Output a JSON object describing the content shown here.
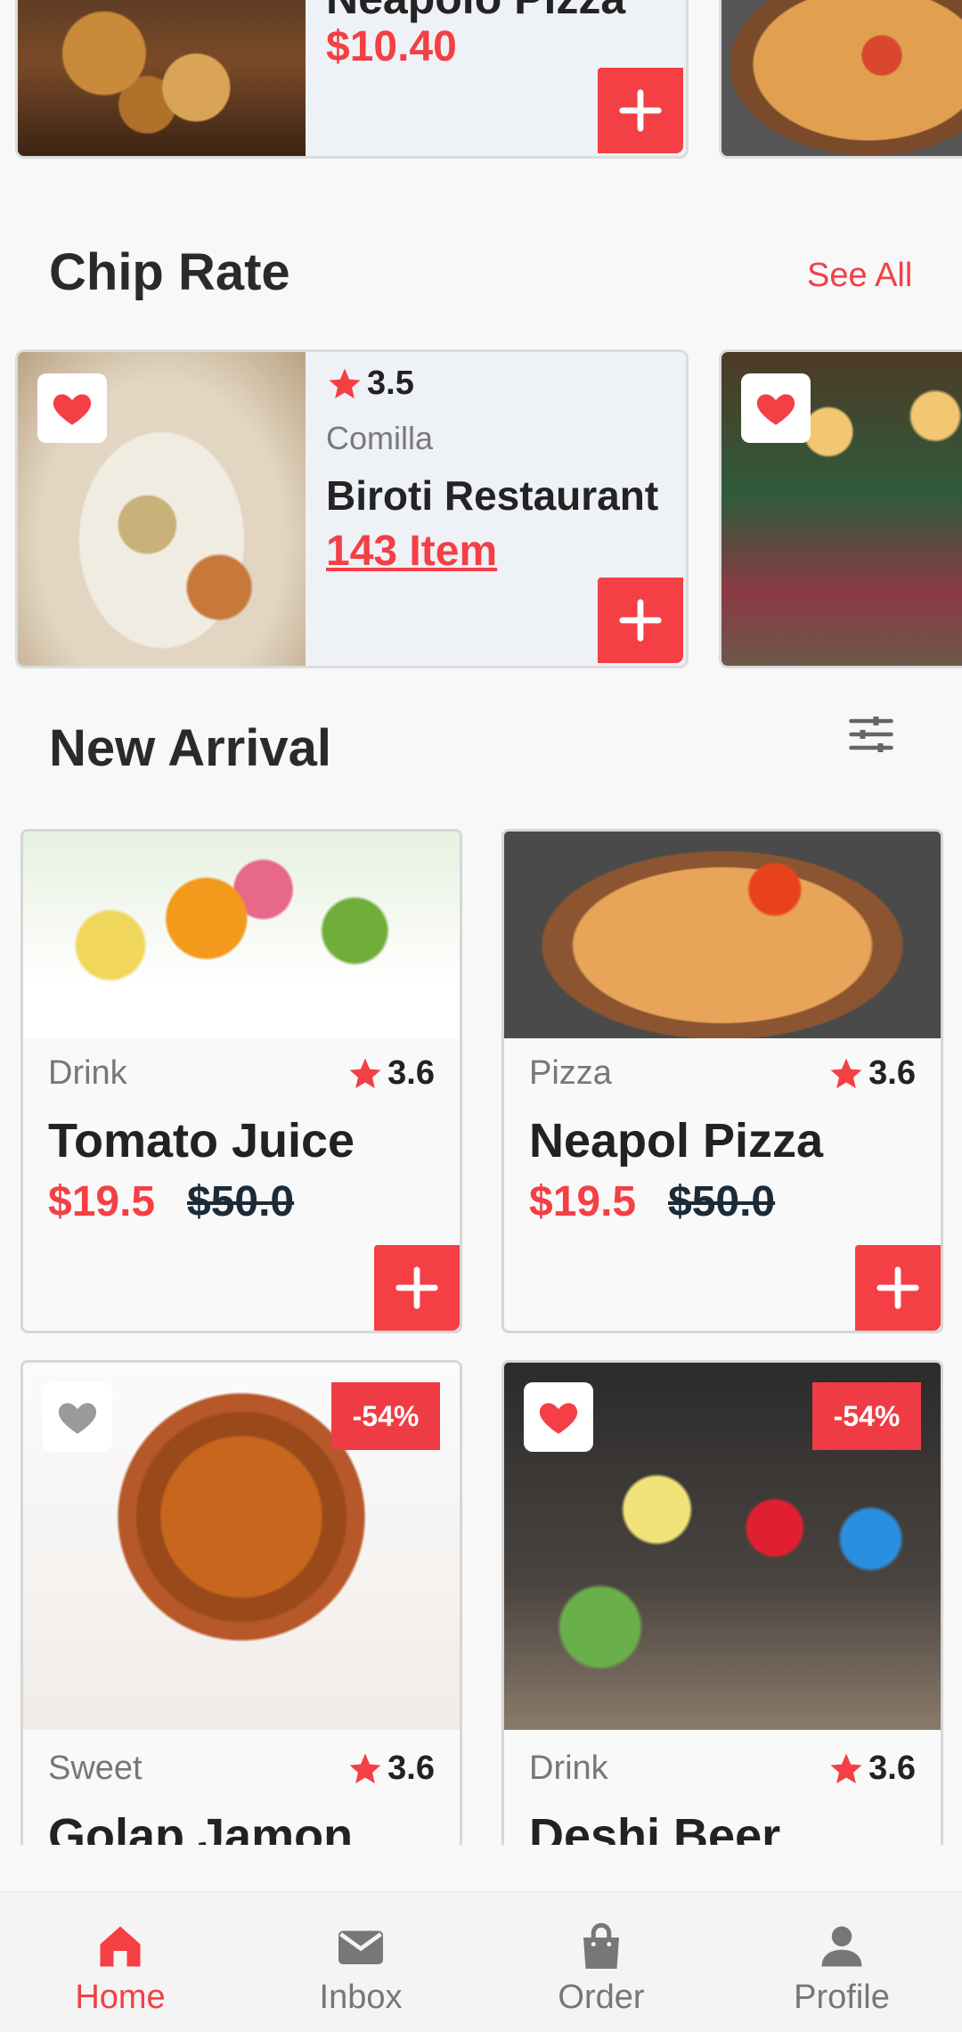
{
  "top_row": {
    "card_title": "Neapolo Pizza",
    "card_price": "$10.40"
  },
  "chip_rate": {
    "title": "Chip Rate",
    "see_all": "See All",
    "card": {
      "rating": "3.5",
      "location": "Comilla",
      "name": "Biroti Restaurant",
      "items": "143 Item"
    }
  },
  "new_arrival": {
    "title": "New Arrival",
    "products": [
      {
        "category": "Drink",
        "rating": "3.6",
        "name": "Tomato Juice",
        "price": "$19.5",
        "old_price": "$50.0"
      },
      {
        "category": "Pizza",
        "rating": "3.6",
        "name": "Neapol Pizza",
        "price": "$19.5",
        "old_price": "$50.0"
      },
      {
        "category": "Sweet",
        "rating": "3.6",
        "name": "Golap Jamon",
        "discount": "-54%"
      },
      {
        "category": "Drink",
        "rating": "3.6",
        "name": "Deshi Beer",
        "discount": "-54%"
      }
    ]
  },
  "nav": {
    "items": [
      {
        "label": "Home",
        "icon": "home-icon",
        "active": true
      },
      {
        "label": "Inbox",
        "icon": "mail-icon"
      },
      {
        "label": "Order",
        "icon": "bag-icon"
      },
      {
        "label": "Profile",
        "icon": "person-icon"
      }
    ]
  },
  "colors": {
    "accent": "#f43f45",
    "card_bg": "#eef1f5",
    "background": "#f8f8f8"
  }
}
